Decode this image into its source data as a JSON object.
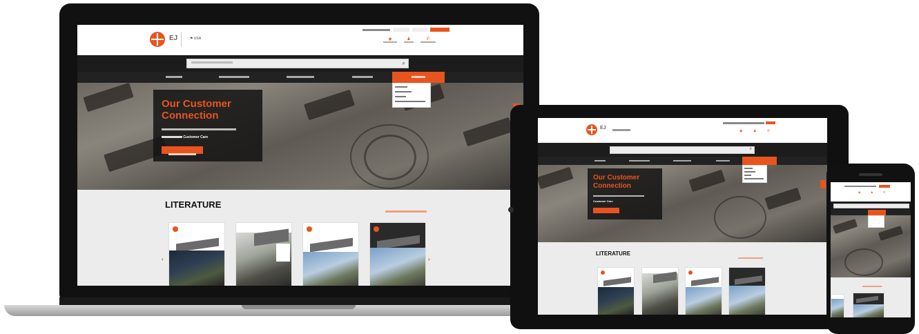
{
  "brand": {
    "logo_icon": "cross-in-circle-logo",
    "logo_tag": "EJ",
    "accent": "#e8541e",
    "dark": "#1c1c1c"
  },
  "header": {
    "location_label": "USA",
    "top_links": [
      "",
      ""
    ],
    "top_buttons": [
      "",
      "",
      ""
    ],
    "utility": [
      {
        "icon": "globe-icon",
        "label": ""
      },
      {
        "icon": "user-icon",
        "label": ""
      },
      {
        "icon": "phone-icon",
        "label": ""
      }
    ]
  },
  "search": {
    "placeholder": "",
    "icon": "search-icon"
  },
  "nav": {
    "items": [
      "",
      "",
      "",
      "",
      ""
    ],
    "active_index": 4,
    "dropdown": [
      "",
      "",
      "",
      ""
    ]
  },
  "hero": {
    "title_line1": "Our Customer",
    "title_line2": "Connection",
    "text_line1": "",
    "text_line2_a": "",
    "text_line2_b": "Customer Care",
    "button": ""
  },
  "literature": {
    "title": "LITERATURE",
    "view_all": ""
  },
  "tablet": {
    "hero_title_line1": "Our Customer",
    "hero_title_line2": "Connection",
    "hero_text_b": "Customer Care",
    "literature_title": "LITERATURE"
  }
}
